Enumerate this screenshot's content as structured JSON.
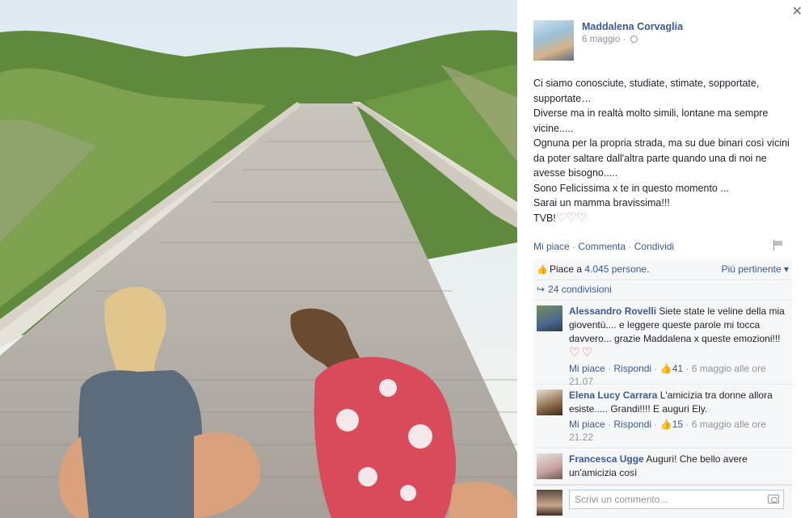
{
  "photo": {
    "description_icon": "photo"
  },
  "post": {
    "author": "Maddalena Corvaglia",
    "date": "6 maggio",
    "date_sep": "·",
    "lines": [
      "Ci siamo conosciute, studiate, stimate, sopportate, supportate…",
      "Diverse ma in realtà molto simili, lontane ma sempre vicine.....",
      "Ognuna per la propria strada, ma su due binari così vicini da poter saltare dall'altra parte quando una di noi ne avesse bisogno.....",
      "Sono Felicissima x te in questo momento ...",
      "Sarai un mamma bravissima!!!"
    ],
    "last_line": "TVB!",
    "hearts": "♡♡♡"
  },
  "actions": {
    "like": "Mi piace",
    "comment": "Commenta",
    "share": "Condividi",
    "sep": " · "
  },
  "likes": {
    "prefix": "Piace a ",
    "count": "4.045 persone",
    "suffix": ".",
    "sort": "Più pertinente ▾"
  },
  "shares": {
    "text": "24 condivisioni"
  },
  "comments": [
    {
      "name": "Alessandro Rovelli",
      "text": "Siete state le veline della mia gioventù.... e leggere queste parole mi tocca davvero... grazie Maddalena x queste emozioni!!!",
      "emoji": "♡ ♡",
      "like": "Mi piace",
      "reply": "Rispondi",
      "likes": "41",
      "time": "6 maggio alle ore 21.07"
    },
    {
      "name": "Elena Lucy Carrara",
      "text": "L'amicizia tra donne allora esiste..... Grandi!!!! E auguri Ely.",
      "emoji": "",
      "like": "Mi piace",
      "reply": "Rispondi",
      "likes": "15",
      "time": "6 maggio alle ore 21.22"
    },
    {
      "name": "Francesca Ugge",
      "text": "Auguri! Che bello avere un'amicizia così",
      "emoji": "",
      "like": "",
      "reply": "",
      "likes": "",
      "time": ""
    }
  ],
  "compose": {
    "placeholder": "Scrivi un commento..."
  },
  "close": "✕"
}
